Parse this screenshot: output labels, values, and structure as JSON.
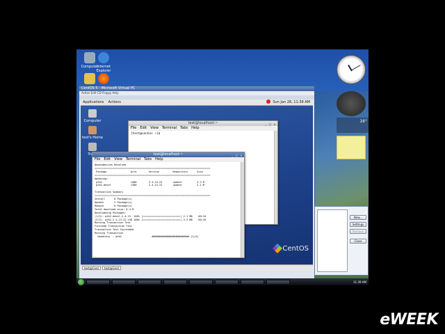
{
  "desktop": {
    "icons": [
      {
        "label": "Computer"
      },
      {
        "label": "Internet Explorer"
      },
      {
        "label": ""
      },
      {
        "label": ""
      }
    ],
    "weather_temp": "16°"
  },
  "vm_window": {
    "title": "CentOS 5 - Microsoft Virtual PC",
    "menu": "Action  Edit  CD  Floppy  Help"
  },
  "gnome_panel": {
    "applications": "Applications",
    "actions": "Actions",
    "clock": "Sun Jan 28, 11:39 AM"
  },
  "gnome_icons": [
    {
      "label": "Computer"
    },
    {
      "label": "test's Home"
    },
    {
      "label": "Trash"
    }
  ],
  "term_back": {
    "title": "test@localhost:~",
    "menu": [
      "File",
      "Edit",
      "View",
      "Terminal",
      "Tabs",
      "Help"
    ],
    "body": "[test@centos ~]$ "
  },
  "term_front": {
    "title": "test@localhost:~",
    "menu": [
      "File",
      "Edit",
      "View",
      "Terminal",
      "Tabs",
      "Help"
    ],
    "body": "Dependencies Resolved\n=============================================================================\n Package                Arch        Version         Repository      Size\n=============================================================================\nUpdating:\n gtk2                   i386        2.4.13-22       update          4.3 M\n gtk2-devel             i386        2.4.13-22       update          2.1 M\n\nTransaction Summary\n=============================================================================\nInstall      0 Package(s)\nUpdate       2 Package(s)\nRemove       0 Package(s)\nTotal download size: 6.4 M\nDownloading Packages:\n(1/2): gtk2-devel-2.4.13- 100% |=========================| 2.1 MB    00:10\n(2/2): gtk2-2.4.13-22.i38 100% |=========================| 4.3 MB    00:20\nRunning Transaction Test\nFinished Transaction Test\nTransaction Test Succeeded\nRunning Transaction\n  Updating  : gtk2                    ######################### [1/4]"
  },
  "centos_logo": "CentOS",
  "gnome_taskbar": [
    "test@Cent",
    "test@Cent"
  ],
  "taskbar": {
    "items": [
      "",
      "",
      "",
      "",
      "",
      "",
      "",
      ""
    ],
    "clock": "11:39 AM"
  },
  "dialog": {
    "buttons": [
      "New...",
      "Settings",
      "Remove",
      "Close"
    ]
  },
  "brand": "eWEEK"
}
